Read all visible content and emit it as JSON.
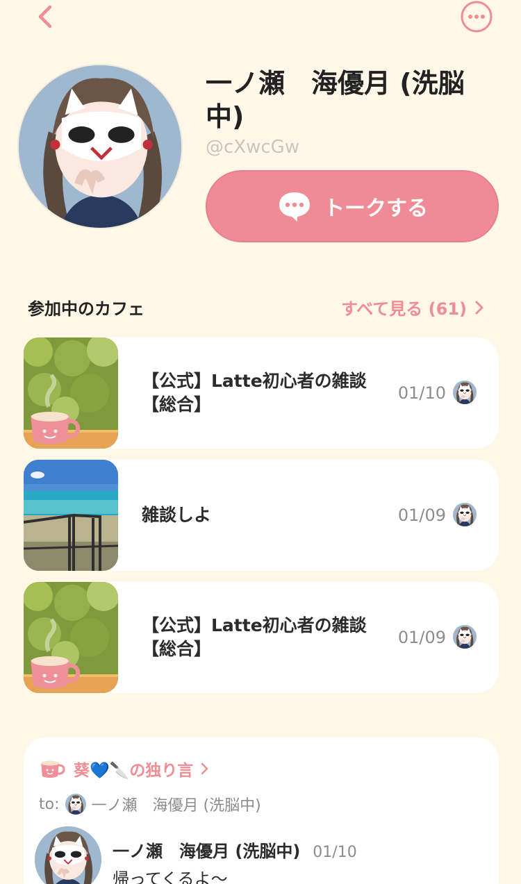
{
  "colors": {
    "background": "#fff8e9",
    "accent": "#ef8b95",
    "card": "#ffffff"
  },
  "profile": {
    "name": "一ノ瀬　海優月 (洗脳中)",
    "handle": "@cXwcGw",
    "talk_button_label": "トークする"
  },
  "cafes": {
    "section_title": "参加中のカフェ",
    "see_all_label": "すべて見る (61)",
    "items": [
      {
        "name_line1": "【公式】Latte初心者の雑談",
        "name_line2": "【総合】",
        "date": "01/10",
        "thumb": "coffee-cup"
      },
      {
        "name_line1": "雑談しよ",
        "name_line2": "",
        "date": "01/09",
        "thumb": "beach"
      },
      {
        "name_line1": "【公式】Latte初心者の雑談",
        "name_line2": "【総合】",
        "date": "01/09",
        "thumb": "coffee-cup"
      }
    ]
  },
  "post": {
    "header_label": "葵💙🔪の独り言",
    "to_label": "to:",
    "to_name": "一ノ瀬　海優月 (洗脳中)",
    "author": "一ノ瀬　海優月 (洗脳中)",
    "date": "01/10",
    "text": "帰ってくるよ〜"
  }
}
